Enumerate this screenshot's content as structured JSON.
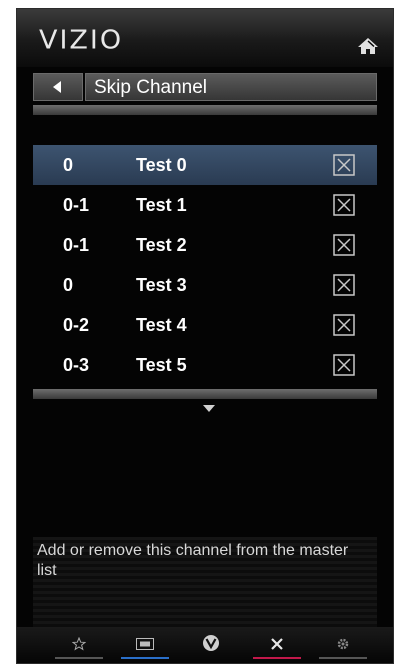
{
  "header": {
    "logo_text": "VIZIO",
    "home_icon": "home-icon"
  },
  "title_bar": {
    "back_icon": "back-arrow-icon",
    "title": "Skip Channel"
  },
  "channels": [
    {
      "number": "0",
      "name": "Test 0",
      "checked": true,
      "selected": true
    },
    {
      "number": "0-1",
      "name": "Test 1",
      "checked": true,
      "selected": false
    },
    {
      "number": "0-1",
      "name": "Test 2",
      "checked": true,
      "selected": false
    },
    {
      "number": "0",
      "name": "Test 3",
      "checked": true,
      "selected": false
    },
    {
      "number": "0-2",
      "name": "Test 4",
      "checked": true,
      "selected": false
    },
    {
      "number": "0-3",
      "name": "Test 5",
      "checked": true,
      "selected": false
    }
  ],
  "scroll_icon": "chevron-down-icon",
  "help": {
    "text": "Add or remove this channel from the master list"
  },
  "footer": {
    "buttons": [
      {
        "icon": "star-icon",
        "color": "#555555"
      },
      {
        "icon": "screen-icon",
        "color": "#2a6fc9"
      },
      {
        "icon": "vizio-v-icon",
        "color": "#555555"
      },
      {
        "icon": "close-icon",
        "color": "#c2184a"
      },
      {
        "icon": "gear-icon",
        "color": "#555555"
      }
    ]
  },
  "colors": {
    "selected_row": "#34495f",
    "panel_bg": "#040404"
  }
}
